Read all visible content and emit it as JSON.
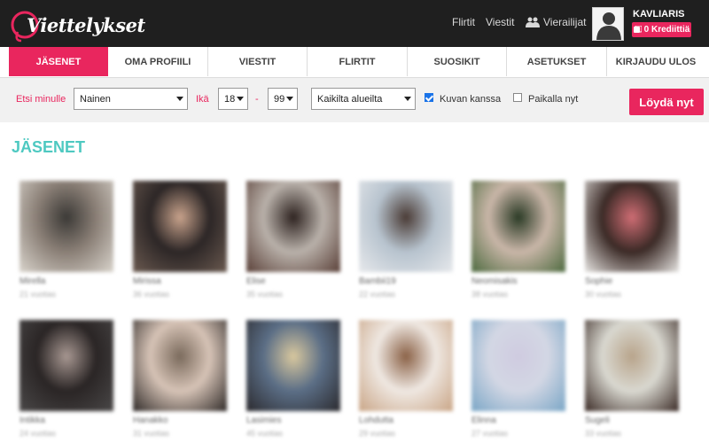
{
  "colors": {
    "accent": "#e9265e",
    "teal": "#4ec9c1",
    "topbar": "#1f1f1f",
    "filter_bg": "#f1f1f1"
  },
  "brand": {
    "logo_text": "Viettelykset"
  },
  "header": {
    "links": {
      "flirtit": "Flirtit",
      "viestit": "Viestit",
      "visitors": "Vierailijat"
    },
    "user": {
      "username": "KAVLIARIS",
      "credits": "0 Krediittiä"
    }
  },
  "nav": {
    "tabs": [
      {
        "label": "JÄSENET",
        "active": true
      },
      {
        "label": "OMA PROFIILI",
        "active": false
      },
      {
        "label": "VIESTIT",
        "active": false
      },
      {
        "label": "FLIRTIT",
        "active": false
      },
      {
        "label": "SUOSIKIT",
        "active": false
      },
      {
        "label": "ASETUKSET",
        "active": false
      },
      {
        "label": "KIRJAUDU ULOS",
        "active": false
      }
    ]
  },
  "filters": {
    "search_for_label": "Etsi minulle",
    "gender_value": "Nainen",
    "age_label": "Ikä",
    "age_min": "18",
    "age_max": "99",
    "region_value": "Kaikilta alueilta",
    "with_photo_label": "Kuvan kanssa",
    "with_photo_checked": true,
    "online_label": "Paikalla nyt",
    "online_checked": false,
    "find_button": "Löydä nyt"
  },
  "members": {
    "title": "JÄSENET",
    "items": [
      {
        "name": "Mirella",
        "age": "21 vuotias",
        "palette": [
          "#d9d4cc",
          "#8a7f76",
          "#3b3936"
        ]
      },
      {
        "name": "Mirissa",
        "age": "36 vuotias",
        "palette": [
          "#6b5a50",
          "#2c2626",
          "#c9a38c"
        ]
      },
      {
        "name": "Elise",
        "age": "35 vuotias",
        "palette": [
          "#5a4038",
          "#b9b1aa",
          "#2e2320"
        ]
      },
      {
        "name": "Bambii19",
        "age": "22 vuotias",
        "palette": [
          "#e7e9ec",
          "#b7c3ce",
          "#4a3b35"
        ]
      },
      {
        "name": "Neomisakis",
        "age": "38 vuotias",
        "palette": [
          "#4d6a3f",
          "#c9b6a8",
          "#2a3a25"
        ]
      },
      {
        "name": "Sophie",
        "age": "30 vuotias",
        "palette": [
          "#e8e6e3",
          "#3b2a26",
          "#cf6d74"
        ]
      },
      {
        "name": "Intikka",
        "age": "24 vuotias",
        "palette": [
          "#4a4848",
          "#2a2525",
          "#a89892"
        ]
      },
      {
        "name": "Hanakko",
        "age": "31 vuotias",
        "palette": [
          "#2f2a28",
          "#d6c3b6",
          "#7a6a5c"
        ]
      },
      {
        "name": "Lasimies",
        "age": "45 vuotias",
        "palette": [
          "#2b2a2e",
          "#5b6e86",
          "#d9c89e"
        ]
      },
      {
        "name": "Lohdutta",
        "age": "29 vuotias",
        "palette": [
          "#c9a586",
          "#efe8e2",
          "#8b6247"
        ]
      },
      {
        "name": "Elinna",
        "age": "27 vuotias",
        "palette": [
          "#7aa6c6",
          "#d3d7e4",
          "#cfcbe0"
        ]
      },
      {
        "name": "Sugeli",
        "age": "33 vuotias",
        "palette": [
          "#3a2a25",
          "#d9d8d0",
          "#b8a48b"
        ]
      }
    ]
  }
}
